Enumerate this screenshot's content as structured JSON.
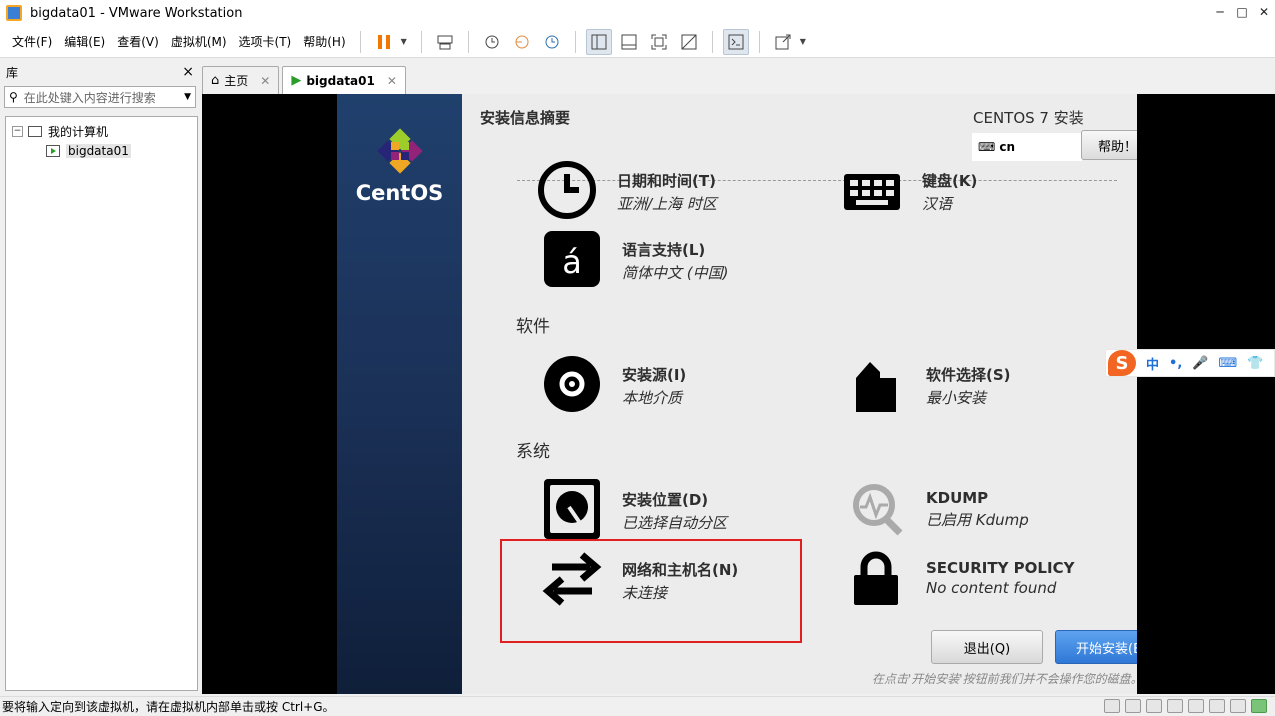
{
  "window": {
    "title": "bigdata01 - VMware Workstation",
    "controls": [
      "─",
      "□",
      "✕"
    ]
  },
  "menu": [
    "文件(F)",
    "编辑(E)",
    "查看(V)",
    "虚拟机(M)",
    "选项卡(T)",
    "帮助(H)"
  ],
  "toolbar": {
    "icons": [
      "pause-icon",
      "send-keys-icon",
      "snapshot-icon",
      "revert-snapshot-icon",
      "snapshot-manager-icon",
      "library-view-icon",
      "thumbnail-bar-icon",
      "fullscreen-icon",
      "unity-icon",
      "console-icon",
      "stretch-icon"
    ]
  },
  "library": {
    "title": "库",
    "close": "×",
    "search_placeholder": "在此处键入内容进行搜索",
    "tree": {
      "root": "我的计算机",
      "children": [
        "bigdata01"
      ]
    }
  },
  "tabs": [
    {
      "label": "主页",
      "active": false
    },
    {
      "label": "bigdata01",
      "active": true
    }
  ],
  "installer": {
    "brand": "CentOS",
    "header_title": "安装信息摘要",
    "product": "CENTOS 7 安装",
    "keyboard_layout": "cn",
    "help_label": "帮助！",
    "categories": {
      "software": "软件",
      "system": "系统"
    },
    "spokes": {
      "datetime": {
        "title": "日期和时间(T)",
        "status": "亚洲/上海 时区"
      },
      "keyboard": {
        "title": "键盘(K)",
        "status": "汉语"
      },
      "language": {
        "title": "语言支持(L)",
        "status": "简体中文 (中国)"
      },
      "source": {
        "title": "安装源(I)",
        "status": "本地介质"
      },
      "software": {
        "title": "软件选择(S)",
        "status": "最小安装"
      },
      "destination": {
        "title": "安装位置(D)",
        "status": "已选择自动分区"
      },
      "kdump": {
        "title": "KDUMP",
        "status": "已启用 Kdump"
      },
      "network": {
        "title": "网络和主机名(N)",
        "status": "未连接"
      },
      "security": {
        "title": "SECURITY POLICY",
        "status": "No content found"
      }
    },
    "quit_label": "退出(Q)",
    "begin_label": "开始安装(B)",
    "footnote": "在点击'开始安装'按钮前我们并不会操作您的磁盘。"
  },
  "ime": {
    "logo": "S",
    "items": [
      "中",
      "•,",
      "🎤",
      "⌨",
      "👕"
    ]
  },
  "statusbar": {
    "message": "要将输入定向到该虚拟机，请在虚拟机内部单击或按 Ctrl+G。"
  },
  "colors": {
    "highlight": "#e02020",
    "accent": "#2f78d6",
    "sidebar": "#1a2f55",
    "pause": "#f07800"
  }
}
